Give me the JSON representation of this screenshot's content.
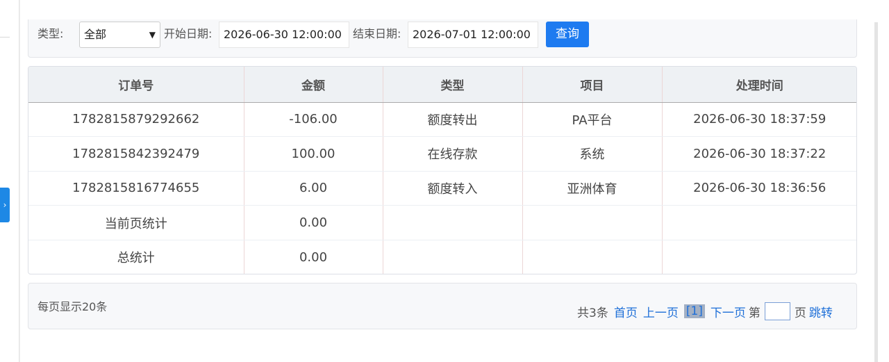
{
  "filter": {
    "type_label": "类型:",
    "type_value": "全部",
    "start_label": "开始日期:",
    "start_value": "2026-06-30 12:00:00",
    "end_label": "结束日期:",
    "end_value": "2026-07-01 12:00:00",
    "query_button": "查询"
  },
  "table": {
    "headers": [
      "订单号",
      "金额",
      "类型",
      "项目",
      "处理时间"
    ],
    "rows": [
      [
        "1782815879292662",
        "-106.00",
        "额度转出",
        "PA平台",
        "2026-06-30 18:37:59"
      ],
      [
        "1782815842392479",
        "100.00",
        "在线存款",
        "系统",
        "2026-06-30 18:37:22"
      ],
      [
        "1782815816774655",
        "6.00",
        "额度转入",
        "亚洲体育",
        "2026-06-30 18:36:56"
      ],
      [
        "当前页统计",
        "0.00",
        "",
        "",
        ""
      ],
      [
        "总统计",
        "0.00",
        "",
        "",
        ""
      ]
    ]
  },
  "pagination": {
    "per_page": "每页显示20条",
    "total": "共3条",
    "first": "首页",
    "prev": "上一页",
    "current": "[1]",
    "next": "下一页",
    "goto_prefix": "第",
    "goto_suffix": "页",
    "jump": "跳转"
  },
  "colors": {
    "accent": "#1e7bf0",
    "link": "#1e6fd8",
    "side_toggle": "#1e88e5"
  },
  "icons": {
    "side_toggle": "chevron-right-icon",
    "select_caret": "chevron-down-icon"
  }
}
